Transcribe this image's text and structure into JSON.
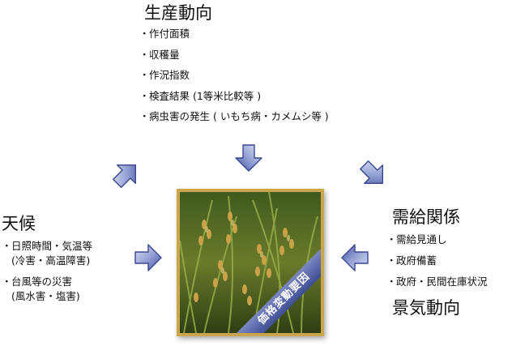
{
  "production": {
    "title": "生産動向",
    "items": [
      "作付面積",
      "収穫量",
      "作況指数",
      "検査結果 (1等米比較等 )",
      "病虫害の発生 ( いもち病・カメムシ等 )"
    ]
  },
  "weather": {
    "title": "天候",
    "items": [
      {
        "label": "日照時間・気温等",
        "sub": "(冷害・高温障害)"
      },
      {
        "label": "台風等の災害",
        "sub": "(風水害・塩害)"
      }
    ]
  },
  "supply_demand": {
    "title": "需給関係",
    "items": [
      "需給見通し",
      "政府備蓄",
      "政府・民間在庫状況"
    ]
  },
  "economy": {
    "title": "景気動向"
  },
  "center": {
    "label": "価格変動要因"
  },
  "bullet_symbol": "・",
  "colors": {
    "arrow_light": "#c8d0ec",
    "arrow_dark": "#4a5aa0",
    "frame": "#c9a64c",
    "ribbon": "#4a58a0"
  },
  "icons": [
    "arrow-up-right-icon",
    "arrow-down-icon",
    "arrow-down-right-icon",
    "arrow-right-icon",
    "arrow-left-icon"
  ]
}
